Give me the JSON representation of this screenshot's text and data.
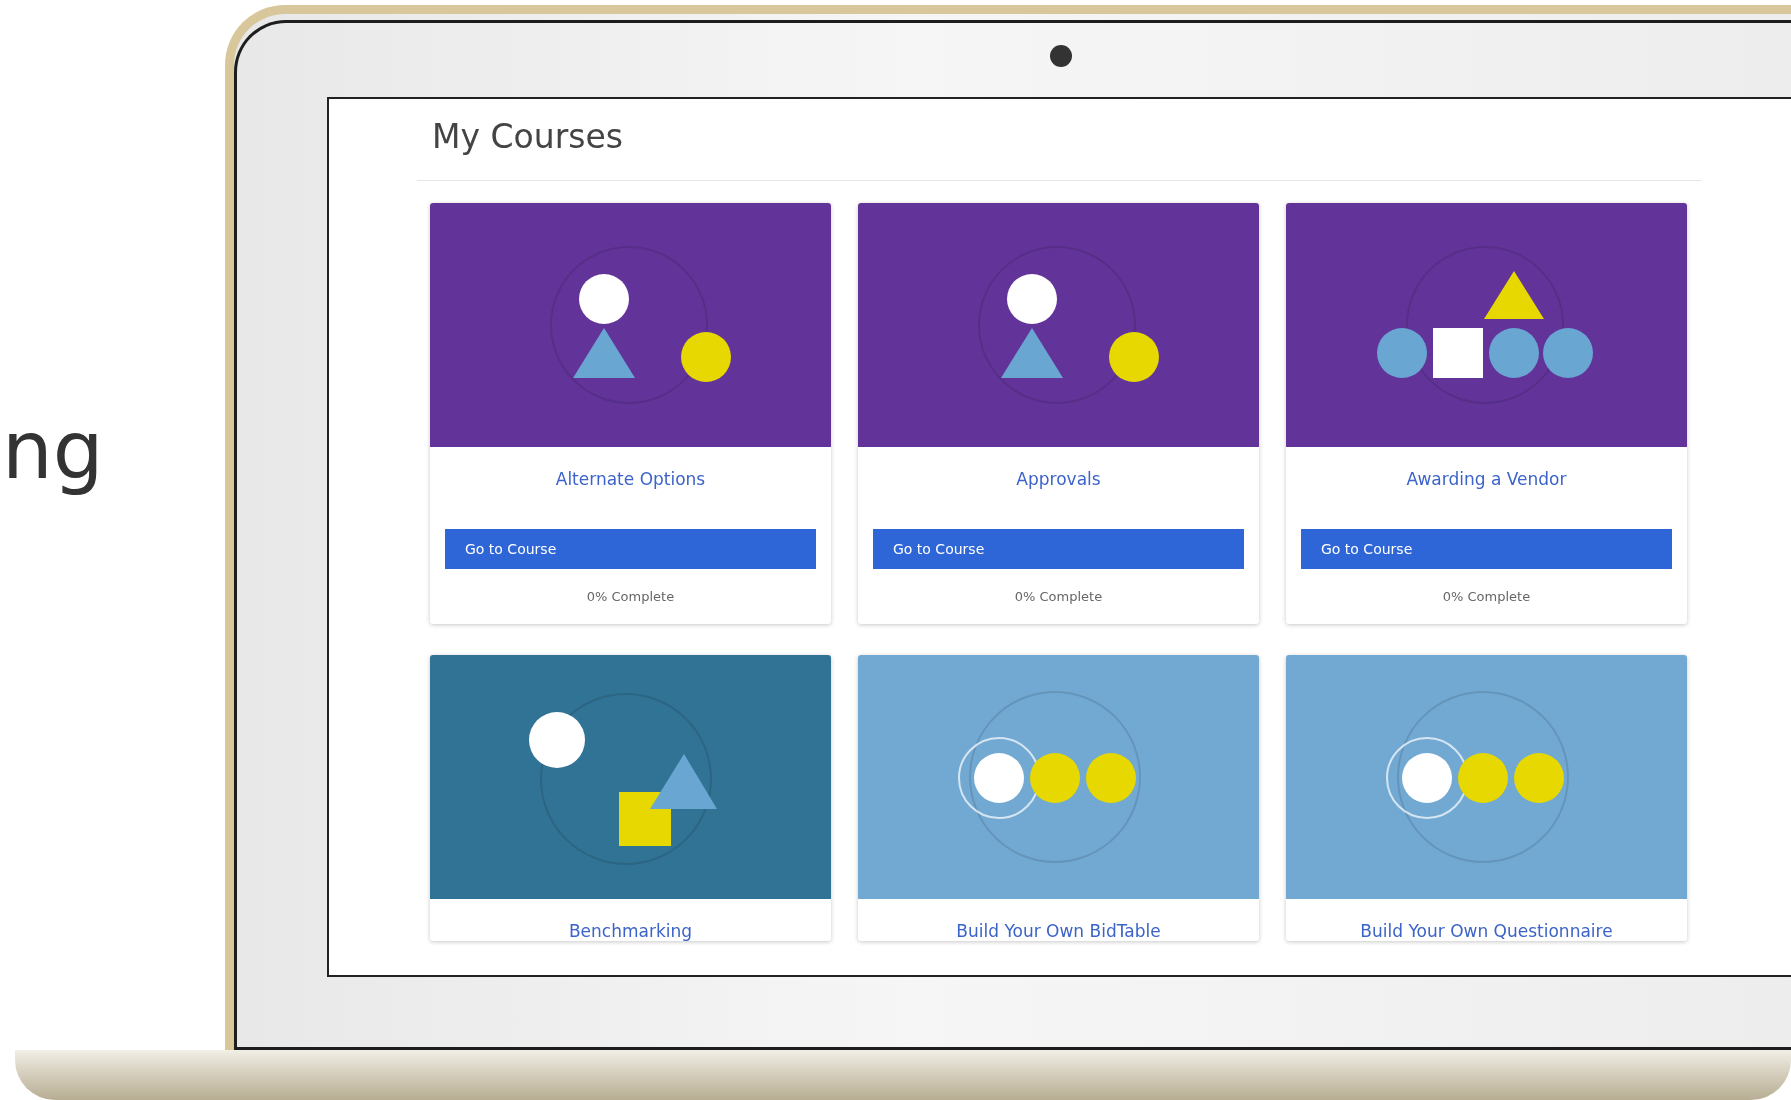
{
  "side_text": "ng",
  "page": {
    "title": "My Courses"
  },
  "courses": [
    {
      "title": "Alternate Options",
      "kind": "figure",
      "color": "#62349a",
      "button": "Go to Course",
      "progress": "0% Complete"
    },
    {
      "title": "Approvals",
      "kind": "figure",
      "color": "#62349a",
      "button": "Go to Course",
      "progress": "0% Complete"
    },
    {
      "title": "Awarding a Vendor",
      "kind": "row",
      "color": "#62349a",
      "button": "Go to Course",
      "progress": "0% Complete"
    },
    {
      "title": "Benchmarking",
      "kind": "stack",
      "color": "#317395"
    },
    {
      "title": "Build Your Own BidTable",
      "kind": "dots",
      "color": "#72a9d3"
    },
    {
      "title": "Build Your Own Questionnaire",
      "kind": "dots",
      "color": "#72a9d3"
    }
  ]
}
